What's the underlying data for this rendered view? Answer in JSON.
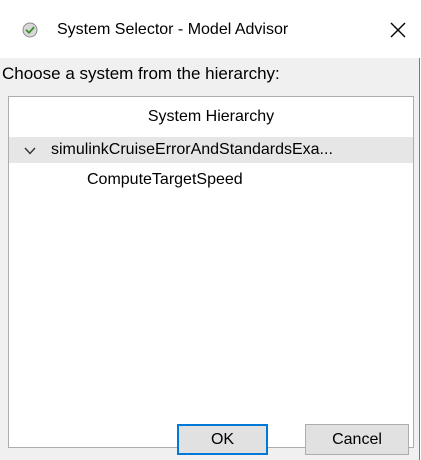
{
  "window": {
    "title": "System Selector - Model Advisor",
    "icon": "check-circle-icon",
    "close_glyph": "✕"
  },
  "prompt": "Choose a system from the hierarchy:",
  "tree": {
    "header": "System Hierarchy",
    "items": [
      {
        "label": "simulinkCruiseErrorAndStandardsExa...",
        "expanded": true,
        "selected": true,
        "children": [
          {
            "label": "ComputeTargetSpeed"
          }
        ]
      }
    ]
  },
  "buttons": {
    "ok": "OK",
    "cancel": "Cancel"
  },
  "colors": {
    "focus_border": "#0078d7",
    "selection": "#e6e6e6",
    "dialog_bg": "#f0f0f0"
  }
}
